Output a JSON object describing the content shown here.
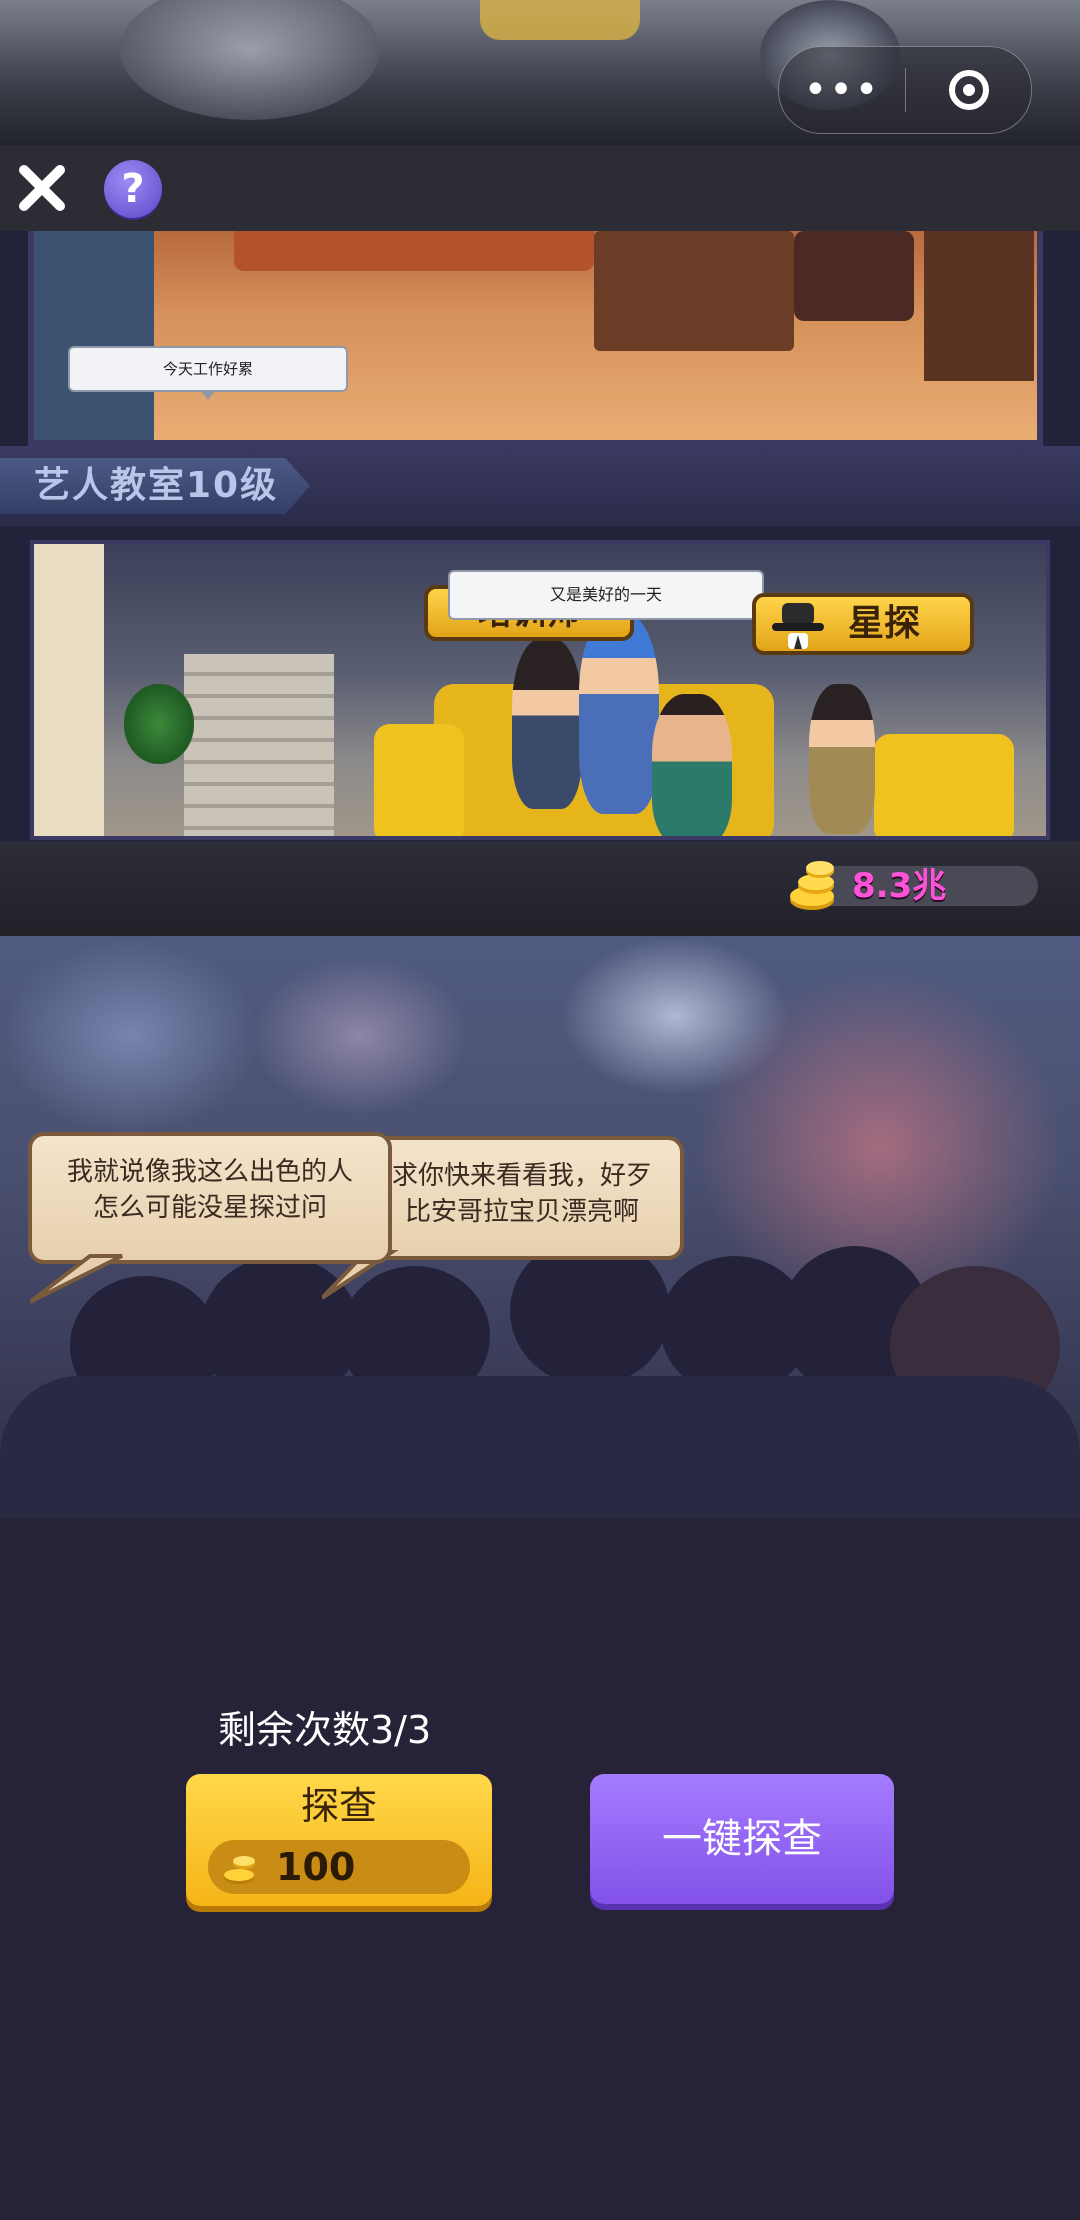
{
  "capsule": {
    "menu_icon": "more-dots-icon",
    "close_icon": "target-circle-icon"
  },
  "toolbar": {
    "close_icon": "close-x-icon",
    "help_label": "?"
  },
  "building": {
    "room1_bubble": "今天工作好累",
    "floor_label": "艺人教室10级",
    "room2_bubble": "又是美好的一天",
    "sign_left": "培训师",
    "sign_right": "星探",
    "sign_right_icon": "detective-hat-icon"
  },
  "currency": {
    "icon": "gold-coins-icon",
    "value": "8.3兆",
    "value_color": "#ff52d8"
  },
  "street": {
    "bubble_left_line1": "我就说像我这么出色的人",
    "bubble_left_line2": "怎么可能没星探过问",
    "bubble_right_line1": "求你快来看看我，好歹",
    "bubble_right_line2": "比安哥拉宝贝漂亮啊"
  },
  "panel": {
    "remaining": "剩余次数3/3",
    "explore_label": "探查",
    "explore_cost_icon": "gold-coins-icon",
    "explore_cost": "100",
    "one_key_label": "一键探查",
    "explore_color": "#f5b417",
    "one_key_color": "#8351e8"
  }
}
